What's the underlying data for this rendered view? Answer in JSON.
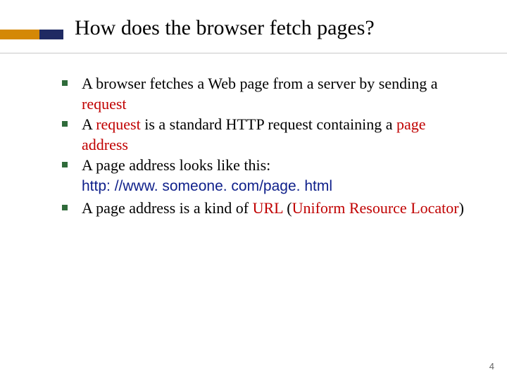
{
  "slide": {
    "title": "How does the browser fetch pages?",
    "bullets": {
      "b1": {
        "pre": "A browser fetches a Web page from a server by sending a ",
        "kw": "request"
      },
      "b2": {
        "pre": "A ",
        "kw1": "request",
        "mid": " is a standard HTTP request containing a ",
        "kw2": "page address"
      },
      "b3": {
        "text": "A page address looks like this:"
      },
      "url": "http: //www. someone. com/page. html",
      "b4": {
        "pre": "A page address is a kind of ",
        "kw": "URL",
        "open": " (",
        "expansion": "Uniform Resource Locator",
        "close": ")"
      }
    },
    "page_number": "4"
  }
}
